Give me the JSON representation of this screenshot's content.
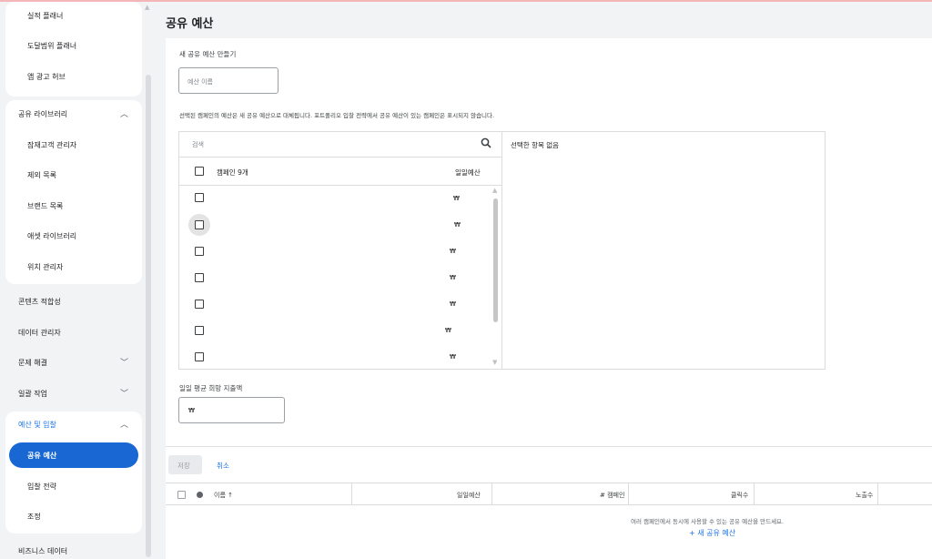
{
  "sidebar": {
    "items_top": [
      "실적 플래너",
      "도달범위 플래너",
      "앱 광고 허브"
    ],
    "shared_library": {
      "header": "공유 라이브러리",
      "items": [
        "잠재고객 관리자",
        "제외 목록",
        "브랜드 목록",
        "애셋 라이브러리",
        "위치 관리자"
      ]
    },
    "content_suitability": "콘텐츠 적합성",
    "data_manager": "데이터 관리자",
    "troubleshooting": "문제 해결",
    "bulk_actions": "일괄 작업",
    "budgets_bidding": {
      "header": "예산 및 입찰",
      "items": [
        "공유 예산",
        "입찰 전략",
        "조정"
      ]
    },
    "business_data": "비즈니스 데이터"
  },
  "page": {
    "title": "공유 예산"
  },
  "form": {
    "new_budget_label": "새 공유 예산 만들기",
    "budget_name_placeholder": "예산 이름",
    "note": "선택된 캠페인의 예산은 새 공유 예산으로 대체됩니다. 포트폴리오 입찰 전략에서 공유 예산이 있는 캠페인은 표시되지 않습니다.",
    "search_placeholder": "검색",
    "campaigns_header": "캠페인 9개",
    "daily_budget_header": "일일예산",
    "currency_symbol": "₩",
    "selected_empty": "선택한 항목 없음",
    "avg_daily_label": "일일 평균 희망 지출액",
    "avg_daily_value": "₩"
  },
  "actions": {
    "save": "저장",
    "cancel": "취소"
  },
  "table": {
    "headers": {
      "name": "이름 ↑",
      "daily_budget": "일일예산",
      "campaigns": "# 캠페인",
      "clicks": "클릭수",
      "impressions": "노출수"
    },
    "empty_message": "여러 캠페인에서 동시에 사용할 수 있는 공유 예산을 만드세요.",
    "new_budget_link": "+ 새 공유 예산"
  },
  "icons": {
    "search": "search-icon",
    "chevron_up": "chevron-up-icon",
    "chevron_down": "chevron-down-icon"
  }
}
